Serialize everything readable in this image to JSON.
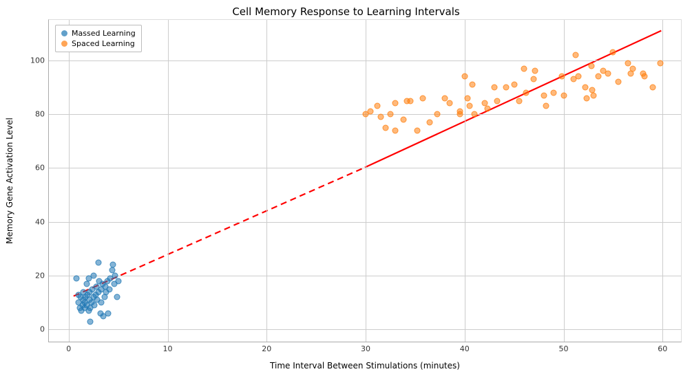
{
  "chart_data": {
    "type": "scatter",
    "title": "Cell Memory Response to Learning Intervals",
    "xlabel": "Time Interval Between Stimulations (minutes)",
    "ylabel": "Memory Gene Activation Level",
    "xlim": [
      -2,
      62
    ],
    "ylim": [
      -5,
      115
    ],
    "xticks": [
      0,
      10,
      20,
      30,
      40,
      50,
      60
    ],
    "yticks": [
      0,
      20,
      40,
      60,
      80,
      100
    ],
    "legend_position": "upper left",
    "series": [
      {
        "name": "Massed Learning",
        "color": "#1f77b4",
        "points": [
          {
            "x": 0.8,
            "y": 19
          },
          {
            "x": 1.0,
            "y": 13
          },
          {
            "x": 1.0,
            "y": 10
          },
          {
            "x": 1.1,
            "y": 8
          },
          {
            "x": 1.2,
            "y": 12
          },
          {
            "x": 1.3,
            "y": 7
          },
          {
            "x": 1.4,
            "y": 9
          },
          {
            "x": 1.5,
            "y": 11
          },
          {
            "x": 1.5,
            "y": 14
          },
          {
            "x": 1.6,
            "y": 8
          },
          {
            "x": 1.6,
            "y": 10
          },
          {
            "x": 1.7,
            "y": 12
          },
          {
            "x": 1.8,
            "y": 17
          },
          {
            "x": 1.8,
            "y": 9
          },
          {
            "x": 1.9,
            "y": 13
          },
          {
            "x": 2.0,
            "y": 7
          },
          {
            "x": 2.0,
            "y": 19
          },
          {
            "x": 2.1,
            "y": 11
          },
          {
            "x": 2.1,
            "y": 14
          },
          {
            "x": 2.2,
            "y": 8
          },
          {
            "x": 2.2,
            "y": 3
          },
          {
            "x": 2.3,
            "y": 10
          },
          {
            "x": 2.4,
            "y": 15
          },
          {
            "x": 2.5,
            "y": 12
          },
          {
            "x": 2.5,
            "y": 20
          },
          {
            "x": 2.6,
            "y": 9
          },
          {
            "x": 2.7,
            "y": 13
          },
          {
            "x": 2.8,
            "y": 16
          },
          {
            "x": 2.9,
            "y": 11
          },
          {
            "x": 3.0,
            "y": 25
          },
          {
            "x": 3.0,
            "y": 14
          },
          {
            "x": 3.1,
            "y": 18
          },
          {
            "x": 3.2,
            "y": 6
          },
          {
            "x": 3.3,
            "y": 10
          },
          {
            "x": 3.3,
            "y": 15
          },
          {
            "x": 3.4,
            "y": 17
          },
          {
            "x": 3.5,
            "y": 5
          },
          {
            "x": 3.6,
            "y": 12
          },
          {
            "x": 3.7,
            "y": 16
          },
          {
            "x": 3.8,
            "y": 14
          },
          {
            "x": 3.9,
            "y": 18
          },
          {
            "x": 4.0,
            "y": 6
          },
          {
            "x": 4.1,
            "y": 15
          },
          {
            "x": 4.2,
            "y": 19
          },
          {
            "x": 4.4,
            "y": 22
          },
          {
            "x": 4.5,
            "y": 24
          },
          {
            "x": 4.6,
            "y": 17
          },
          {
            "x": 4.7,
            "y": 20
          },
          {
            "x": 4.9,
            "y": 12
          },
          {
            "x": 5.0,
            "y": 18
          }
        ]
      },
      {
        "name": "Spaced Learning",
        "color": "#ff7f0e",
        "points": [
          {
            "x": 30.0,
            "y": 80
          },
          {
            "x": 30.5,
            "y": 81
          },
          {
            "x": 31.2,
            "y": 83
          },
          {
            "x": 31.5,
            "y": 79
          },
          {
            "x": 32.0,
            "y": 75
          },
          {
            "x": 32.5,
            "y": 80
          },
          {
            "x": 33.0,
            "y": 84
          },
          {
            "x": 33.0,
            "y": 74
          },
          {
            "x": 33.8,
            "y": 78
          },
          {
            "x": 34.2,
            "y": 85
          },
          {
            "x": 34.5,
            "y": 85
          },
          {
            "x": 35.2,
            "y": 74
          },
          {
            "x": 35.8,
            "y": 86
          },
          {
            "x": 36.5,
            "y": 77
          },
          {
            "x": 37.2,
            "y": 80
          },
          {
            "x": 38.0,
            "y": 86
          },
          {
            "x": 38.5,
            "y": 84
          },
          {
            "x": 39.5,
            "y": 80
          },
          {
            "x": 39.5,
            "y": 81
          },
          {
            "x": 40.0,
            "y": 94
          },
          {
            "x": 40.3,
            "y": 86
          },
          {
            "x": 40.5,
            "y": 83
          },
          {
            "x": 40.8,
            "y": 91
          },
          {
            "x": 41.0,
            "y": 80
          },
          {
            "x": 42.0,
            "y": 84
          },
          {
            "x": 42.3,
            "y": 82
          },
          {
            "x": 43.0,
            "y": 90
          },
          {
            "x": 43.3,
            "y": 85
          },
          {
            "x": 44.2,
            "y": 90
          },
          {
            "x": 45.0,
            "y": 91
          },
          {
            "x": 45.5,
            "y": 85
          },
          {
            "x": 46.0,
            "y": 97
          },
          {
            "x": 46.2,
            "y": 88
          },
          {
            "x": 47.0,
            "y": 93
          },
          {
            "x": 47.1,
            "y": 96
          },
          {
            "x": 48.0,
            "y": 87
          },
          {
            "x": 48.2,
            "y": 83
          },
          {
            "x": 49.0,
            "y": 88
          },
          {
            "x": 49.8,
            "y": 94
          },
          {
            "x": 50.0,
            "y": 87
          },
          {
            "x": 51.0,
            "y": 93
          },
          {
            "x": 51.2,
            "y": 102
          },
          {
            "x": 51.5,
            "y": 94
          },
          {
            "x": 52.2,
            "y": 90
          },
          {
            "x": 52.3,
            "y": 86
          },
          {
            "x": 52.9,
            "y": 89
          },
          {
            "x": 52.8,
            "y": 98
          },
          {
            "x": 53.0,
            "y": 87
          },
          {
            "x": 53.5,
            "y": 94
          },
          {
            "x": 54.0,
            "y": 96
          },
          {
            "x": 54.5,
            "y": 95
          },
          {
            "x": 55.0,
            "y": 103
          },
          {
            "x": 55.5,
            "y": 92
          },
          {
            "x": 56.5,
            "y": 99
          },
          {
            "x": 56.8,
            "y": 95
          },
          {
            "x": 57.0,
            "y": 97
          },
          {
            "x": 58.0,
            "y": 95
          },
          {
            "x": 58.2,
            "y": 94
          },
          {
            "x": 59.0,
            "y": 90
          },
          {
            "x": 59.8,
            "y": 99
          }
        ]
      }
    ],
    "trend_line": {
      "color": "red",
      "segments": [
        {
          "x1": 0.5,
          "y1": 12,
          "x2": 30,
          "y2": 60,
          "style": "dashed"
        },
        {
          "x1": 30,
          "y1": 60,
          "x2": 60,
          "y2": 111,
          "style": "solid"
        }
      ]
    }
  }
}
